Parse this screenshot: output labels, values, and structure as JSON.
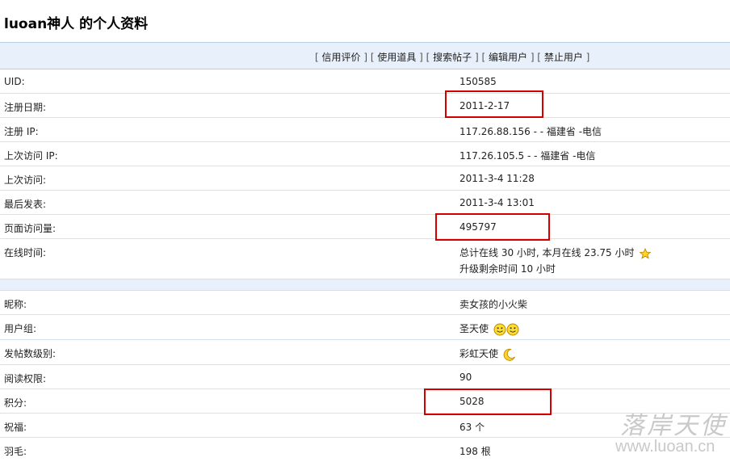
{
  "page": {
    "title": "luoan神人  的个人资料"
  },
  "toolbar": {
    "links": [
      {
        "label": "信用评价"
      },
      {
        "label": "使用道具"
      },
      {
        "label": "搜索帖子"
      },
      {
        "label": "编辑用户"
      },
      {
        "label": "禁止用户"
      }
    ]
  },
  "profile": {
    "uid": {
      "label": "UID:",
      "value": "150585"
    },
    "reg_date": {
      "label": "注册日期:",
      "value": "2011-2-17"
    },
    "reg_ip": {
      "label": "注册  IP:",
      "value": "117.26.88.156 - - 福建省  -电信"
    },
    "last_ip": {
      "label": "上次访问  IP:",
      "value": "117.26.105.5 - - 福建省  -电信"
    },
    "last_visit": {
      "label": "上次访问:",
      "value": "2011-3-4 11:28"
    },
    "last_post": {
      "label": "最后发表:",
      "value": "2011-3-4 13:01"
    },
    "page_views": {
      "label": "页面访问量:",
      "value": "495797"
    },
    "online_time": {
      "label": "在线时间:",
      "line1": "总计在线  30 小时, 本月在线  23.75 小时",
      "line2": "升级剩余时间  10 小时",
      "icon": "star-icon"
    }
  },
  "details": {
    "nickname": {
      "label": "昵称:",
      "value": "卖女孩的小火柴"
    },
    "user_group": {
      "label": "用户组:",
      "value": "圣天使",
      "icon": "smiley-icon"
    },
    "post_level": {
      "label": "发帖数级别:",
      "value": "彩虹天使",
      "icon": "moon-icon"
    },
    "read_perm": {
      "label": "阅读权限:",
      "value": "90"
    },
    "points": {
      "label": "积分:",
      "value": "5028"
    },
    "blessing": {
      "label": "祝福:",
      "value": "63 个"
    },
    "feather": {
      "label": "羽毛:",
      "value": "198 根"
    }
  },
  "watermark": {
    "cn": "落岸天使",
    "url": "www.luoan.cn"
  },
  "colors": {
    "highlight": "#d40000",
    "header_bg": "#e8f1fb",
    "row_border": "#d5e3f1"
  }
}
